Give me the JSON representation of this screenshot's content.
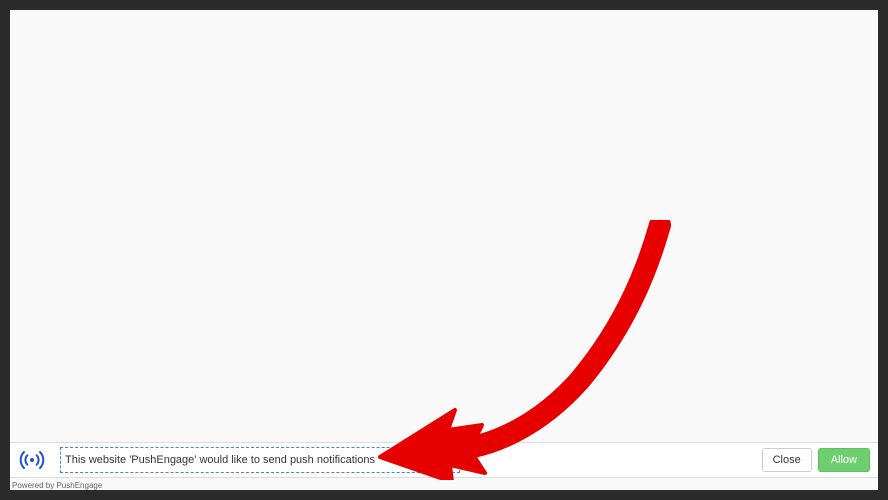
{
  "notification": {
    "message": "This website 'PushEngage' would like to send push notifications",
    "close_label": "Close",
    "allow_label": "Allow",
    "powered_text": "Powered by PushEngage"
  },
  "colors": {
    "allow_bg": "#6fce6f",
    "arrow": "#e60000",
    "icon": "#1e4fd8"
  }
}
